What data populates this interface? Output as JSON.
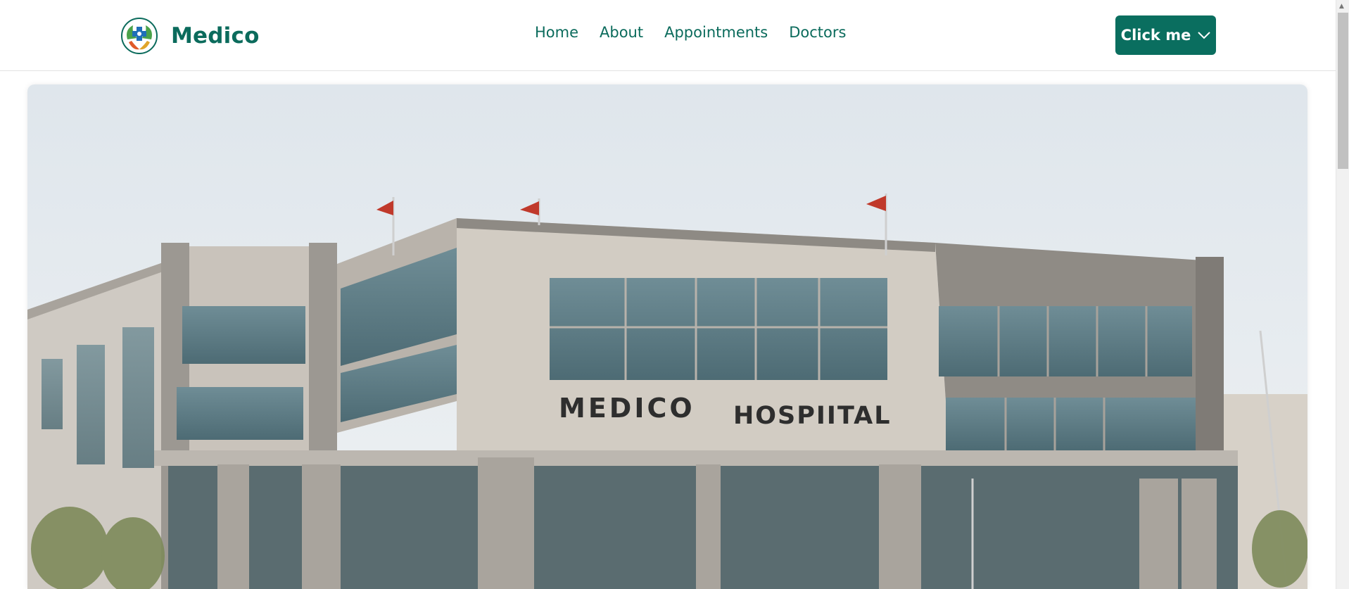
{
  "brand": {
    "name": "Medico",
    "logo_icon": "medical-cross-leaf-icon"
  },
  "nav": {
    "items": [
      "Home",
      "About",
      "Appointments",
      "Doctors"
    ]
  },
  "cta": {
    "label": "Click me",
    "icon": "chevron-down-icon"
  },
  "hero": {
    "sign_text_left": "MEDICO",
    "sign_text_right": "HOSPIITAL"
  },
  "colors": {
    "brand": "#0b6b5c",
    "button_bg": "#0a6e5f"
  }
}
